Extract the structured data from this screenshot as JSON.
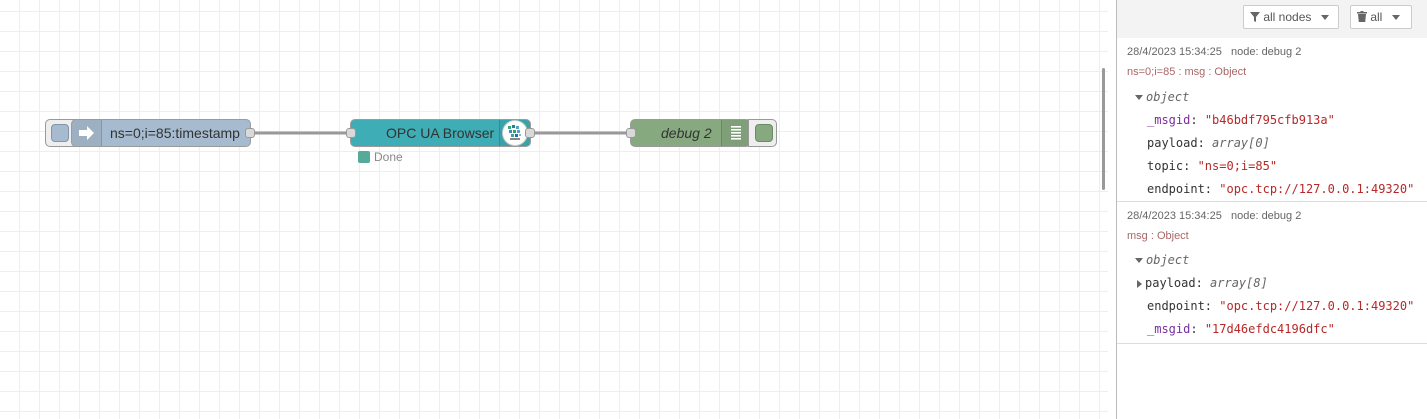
{
  "flow": {
    "inject_label": "ns=0;i=85:timestamp",
    "opcua_label": "OPC UA Browser",
    "opcua_status": "Done",
    "debug_label": "debug 2",
    "colors": {
      "inject": "#a6bbcf",
      "opcua": "#3fadb5",
      "debug": "#87a980",
      "status_ok": "#5a9"
    }
  },
  "sidebar": {
    "filter_label": "all nodes",
    "clear_label": "all",
    "messages": [
      {
        "timestamp": "28/4/2023 15:34:25",
        "node": "node: debug 2",
        "topic_line": "ns=0;i=85 : msg : Object",
        "root": "object",
        "props": [
          {
            "key": "_msgid",
            "sep": ": ",
            "value": "\"b46bdf795cfb913a\""
          },
          {
            "key": "payload",
            "sep": ": ",
            "value": "array[0]"
          },
          {
            "key": "topic",
            "sep": ": ",
            "value": "\"ns=0;i=85\""
          },
          {
            "key": "endpoint",
            "sep": ": ",
            "value": "\"opc.tcp://127.0.0.1:49320\""
          }
        ]
      },
      {
        "timestamp": "28/4/2023 15:34:25",
        "node": "node: debug 2",
        "topic_line": "msg : Object",
        "root": "object",
        "props": [
          {
            "key": "payload",
            "sep": ": ",
            "value": "array[8]"
          },
          {
            "key": "endpoint",
            "sep": ": ",
            "value": "\"opc.tcp://127.0.0.1:49320\""
          },
          {
            "key": "_msgid",
            "sep": ": ",
            "value": "\"17d46efdc4196dfc\""
          }
        ]
      }
    ]
  }
}
